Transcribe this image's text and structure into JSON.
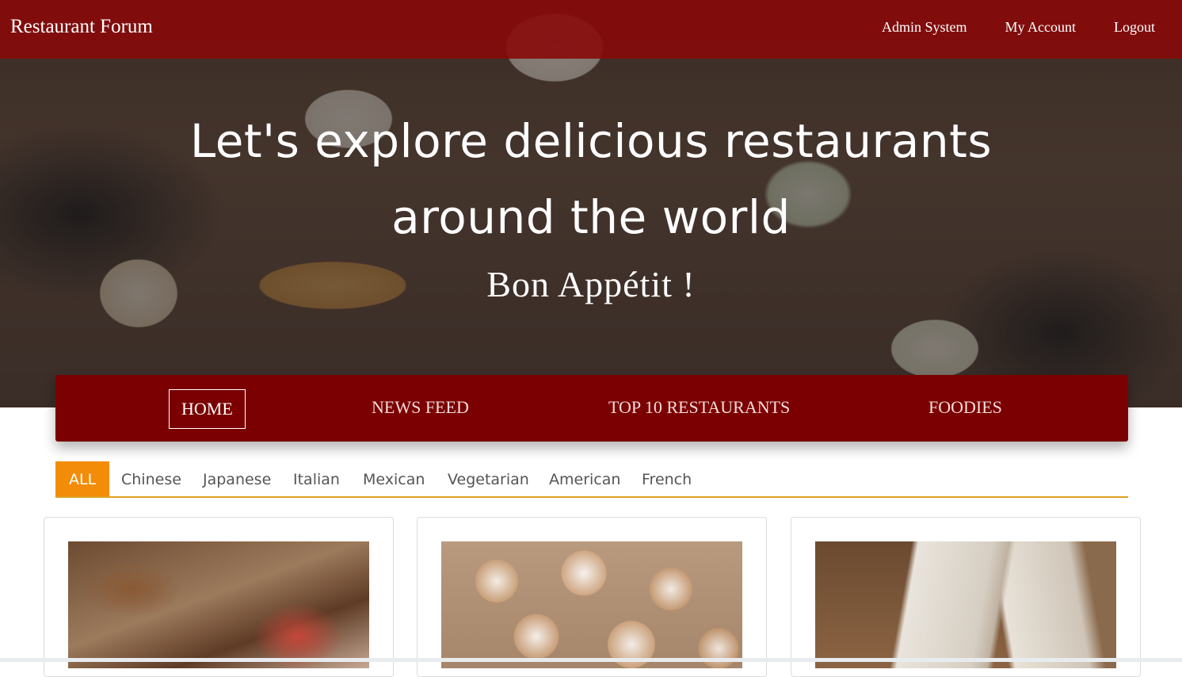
{
  "navbar": {
    "brand": "Restaurant Forum",
    "links": [
      "Admin System",
      "My Account",
      "Logout"
    ]
  },
  "hero": {
    "title": "Let's explore delicious restaurants around the world",
    "subtitle": "Bon Appétit !"
  },
  "section_nav": {
    "items": [
      "HOME",
      "NEWS FEED",
      "TOP 10 RESTAURANTS",
      "FOODIES"
    ],
    "active": "HOME"
  },
  "categories": {
    "items": [
      "ALL",
      "Chinese",
      "Japanese",
      "Italian",
      "Mexican",
      "Vegetarian",
      "American",
      "French"
    ],
    "active": "ALL"
  },
  "colors": {
    "navbar": "#870a0a",
    "section_nav": "#7b0001",
    "active_category": "#f28c09",
    "category_underline": "#e0a020"
  }
}
